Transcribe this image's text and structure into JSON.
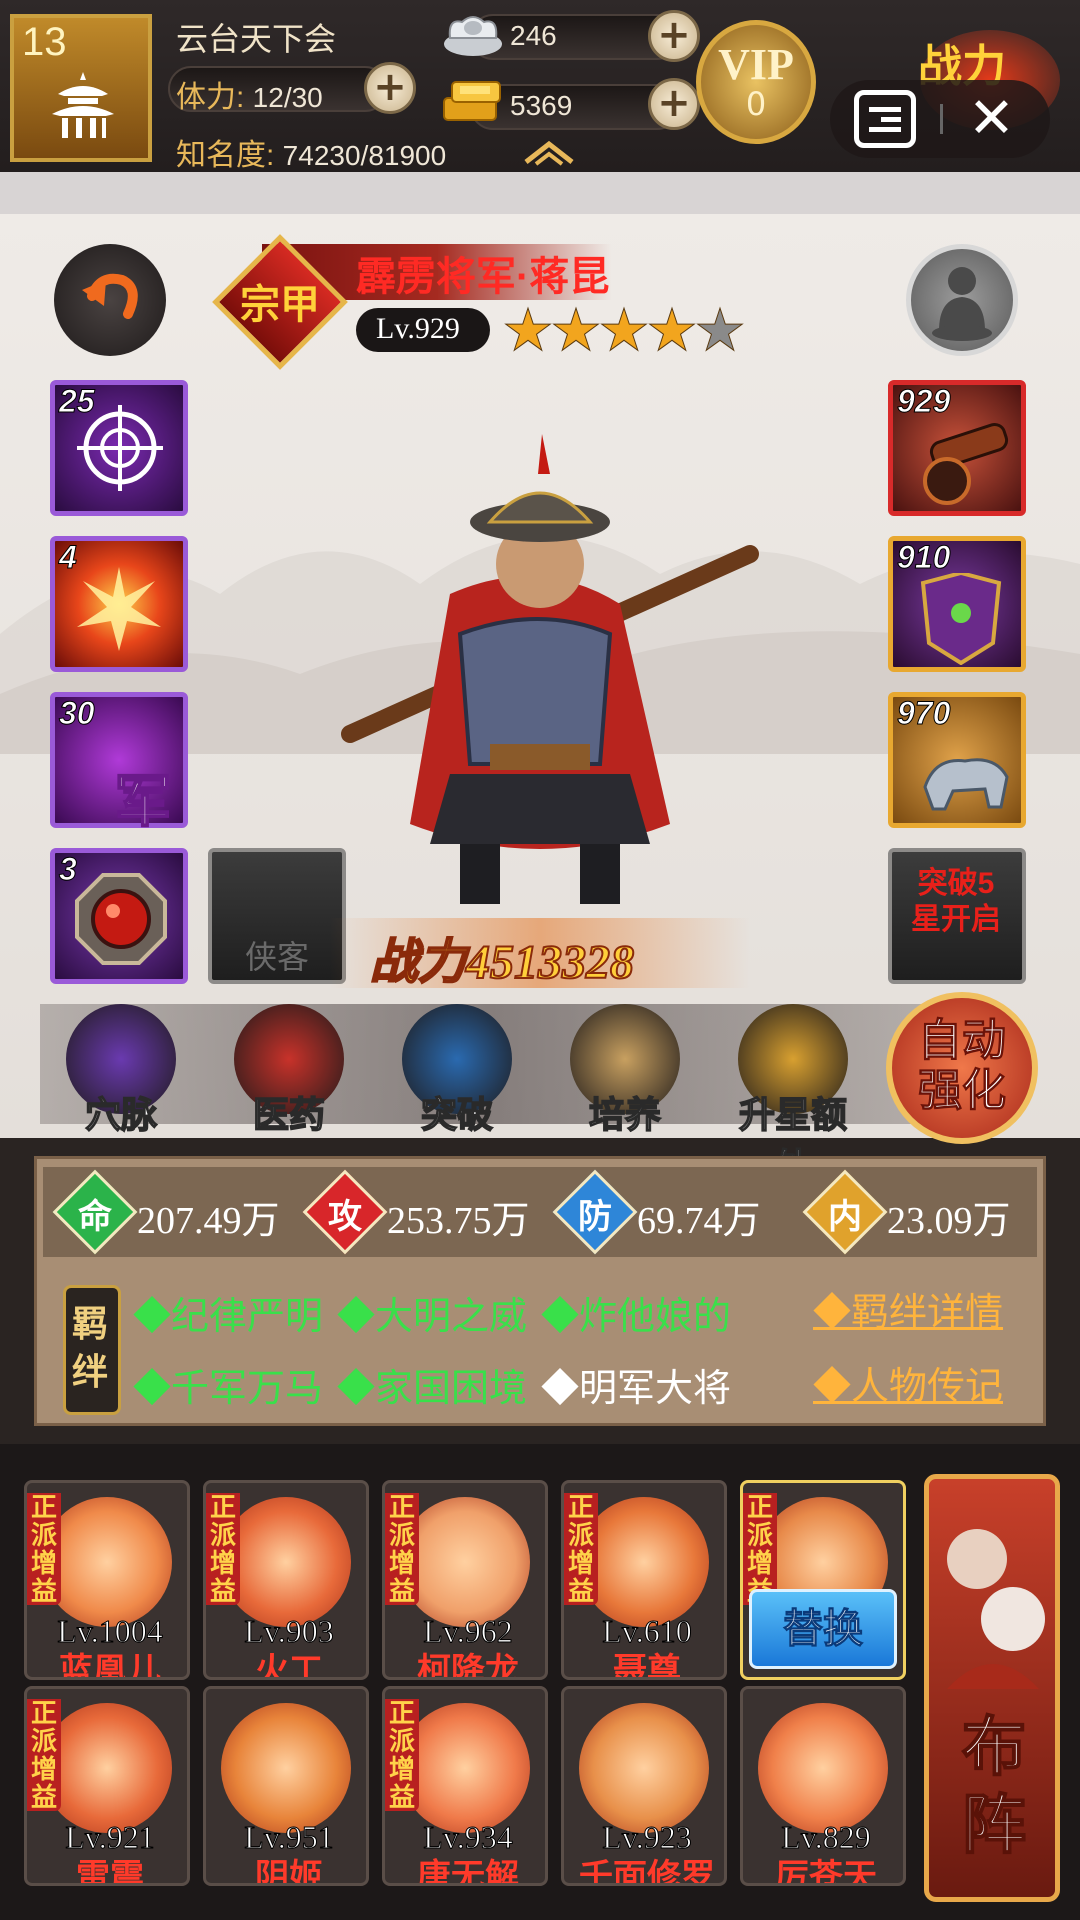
{
  "header": {
    "player_level": "13",
    "guild_name": "云台天下会",
    "stamina_label": "体力: ",
    "stamina_value": "12/30",
    "fame_label": "知名度: ",
    "fame_value": "74230/81900",
    "silver": "246",
    "gold": "5369",
    "vip_label": "VIP",
    "vip_level": "0",
    "power_deco": "战力"
  },
  "hero": {
    "title": "霹雳将军·蒋昆",
    "grade_badge": "宗甲",
    "level": "Lv.929",
    "stars": 4,
    "max_stars": 5,
    "power_label": "战力",
    "power_value": "4513328"
  },
  "skills": [
    {
      "num": "25",
      "icon": "target-icon"
    },
    {
      "num": "4",
      "icon": "explosion-icon"
    },
    {
      "num": "30",
      "icon": "army-icon",
      "text": "军"
    },
    {
      "num": "3",
      "icon": "red-orb-icon"
    }
  ],
  "empty_slot_label": "侠客",
  "equipment": [
    {
      "num": "929",
      "icon": "cannon-icon"
    },
    {
      "num": "910",
      "icon": "armor-icon"
    },
    {
      "num": "970",
      "icon": "silver-beast-icon"
    }
  ],
  "locked_slot_label": "突破5星开启",
  "functions": [
    {
      "label": "穴脉",
      "icon": "meridian-icon"
    },
    {
      "label": "医药",
      "icon": "herb-icon"
    },
    {
      "label": "突破",
      "icon": "breakthrough-icon"
    },
    {
      "label": "培养",
      "icon": "scroll-icon"
    },
    {
      "label": "升星额外",
      "icon": "treasure-icon"
    }
  ],
  "auto_enhance_label": "自动强化",
  "stats": [
    {
      "char": "命",
      "value": "207.49万",
      "color": "#2bb34a"
    },
    {
      "char": "攻",
      "value": "253.75万",
      "color": "#d8262a"
    },
    {
      "char": "防",
      "value": "69.74万",
      "color": "#2e86d8"
    },
    {
      "char": "内",
      "value": "23.09万",
      "color": "#e0a22c"
    }
  ],
  "bonds_label": "羁绊",
  "bonds_row1": [
    "◆纪律严明",
    "◆大明之威",
    "◆炸他娘的"
  ],
  "bonds_row2": [
    "◆千军万马",
    "◆家国困境",
    "◆明军大将"
  ],
  "bond_active_color": "#39e04a",
  "bond_inactive_color": "#ffffff",
  "links": {
    "bond_detail": "◆羁绊详情",
    "biography": "◆人物传记"
  },
  "roster": [
    {
      "level": "Lv.1004",
      "name": "蓝凰儿",
      "tag": true
    },
    {
      "level": "Lv.903",
      "name": "火工",
      "tag": true
    },
    {
      "level": "Lv.962",
      "name": "柯降龙",
      "tag": true
    },
    {
      "level": "Lv.610",
      "name": "聂尊",
      "tag": true
    },
    {
      "level": "",
      "name": "",
      "tag": true,
      "selected": true
    },
    {
      "level": "Lv.921",
      "name": "雷震",
      "tag": true
    },
    {
      "level": "Lv.951",
      "name": "阴姬",
      "tag": false
    },
    {
      "level": "Lv.934",
      "name": "唐无解",
      "tag": true
    },
    {
      "level": "Lv.923",
      "name": "千面修罗",
      "tag": false
    },
    {
      "level": "Lv.829",
      "name": "厉苍天",
      "tag": false
    }
  ],
  "roster_tag": "正派增益",
  "replace_label": "替换",
  "formation_label": "布阵"
}
